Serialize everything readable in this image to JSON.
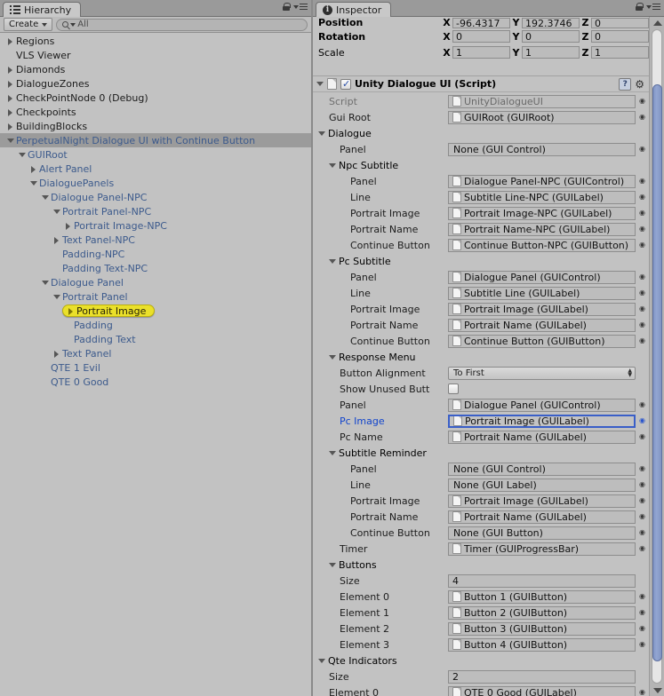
{
  "hierarchy": {
    "tab_label": "Hierarchy",
    "tab_icon": "list-icon",
    "create_label": "Create",
    "search_placeholder": "All",
    "search_value": "All",
    "lock_icon": "lock-icon",
    "menu_icon": "panel-menu-icon",
    "items": [
      {
        "label": "Regions",
        "indent": 0,
        "arrow": "right",
        "style": "normal"
      },
      {
        "label": "VLS Viewer",
        "indent": 0,
        "arrow": "none",
        "style": "normal"
      },
      {
        "label": "Diamonds",
        "indent": 0,
        "arrow": "right",
        "style": "normal"
      },
      {
        "label": "DialogueZones",
        "indent": 0,
        "arrow": "right",
        "style": "normal"
      },
      {
        "label": "CheckPointNode 0 (Debug)",
        "indent": 0,
        "arrow": "right",
        "style": "normal"
      },
      {
        "label": "Checkpoints",
        "indent": 0,
        "arrow": "right",
        "style": "normal"
      },
      {
        "label": "BuildingBlocks",
        "indent": 0,
        "arrow": "right",
        "style": "normal"
      },
      {
        "label": "PerpetualNight Dialogue UI with Continue Button",
        "indent": 0,
        "arrow": "down",
        "style": "prefab",
        "selected": true
      },
      {
        "label": "GUIRoot",
        "indent": 1,
        "arrow": "down",
        "style": "prefab"
      },
      {
        "label": "Alert Panel",
        "indent": 2,
        "arrow": "right",
        "style": "prefab"
      },
      {
        "label": "DialoguePanels",
        "indent": 2,
        "arrow": "down",
        "style": "prefab"
      },
      {
        "label": "Dialogue Panel-NPC",
        "indent": 3,
        "arrow": "down",
        "style": "prefab"
      },
      {
        "label": "Portrait Panel-NPC",
        "indent": 4,
        "arrow": "down",
        "style": "prefab"
      },
      {
        "label": "Portrait Image-NPC",
        "indent": 5,
        "arrow": "right",
        "style": "prefab"
      },
      {
        "label": "Text Panel-NPC",
        "indent": 4,
        "arrow": "right",
        "style": "prefab"
      },
      {
        "label": "Padding-NPC",
        "indent": 4,
        "arrow": "none",
        "style": "prefab"
      },
      {
        "label": "Padding Text-NPC",
        "indent": 4,
        "arrow": "none",
        "style": "prefab"
      },
      {
        "label": "Dialogue Panel",
        "indent": 3,
        "arrow": "down",
        "style": "prefab"
      },
      {
        "label": "Portrait Panel",
        "indent": 4,
        "arrow": "down",
        "style": "prefab"
      },
      {
        "label": "Portrait Image",
        "indent": 5,
        "arrow": "right",
        "style": "prefab",
        "highlight": true
      },
      {
        "label": "Padding",
        "indent": 5,
        "arrow": "none",
        "style": "prefab"
      },
      {
        "label": "Padding Text",
        "indent": 5,
        "arrow": "none",
        "style": "prefab"
      },
      {
        "label": "Text Panel",
        "indent": 4,
        "arrow": "right",
        "style": "prefab"
      },
      {
        "label": "QTE 1 Evil",
        "indent": 3,
        "arrow": "none",
        "style": "prefab"
      },
      {
        "label": "QTE 0 Good",
        "indent": 3,
        "arrow": "none",
        "style": "prefab"
      }
    ]
  },
  "inspector": {
    "tab_label": "Inspector",
    "tab_icon": "info-icon",
    "lock_icon": "lock-icon",
    "menu_icon": "panel-menu-icon",
    "transform": [
      {
        "label": "Position",
        "bold": true,
        "x": "-96.4317",
        "y": "192.3746",
        "z": "0",
        "clipped": true
      },
      {
        "label": "Rotation",
        "bold": true,
        "x": "0",
        "y": "0",
        "z": "0"
      },
      {
        "label": "Scale",
        "bold": false,
        "x": "1",
        "y": "1",
        "z": "1"
      }
    ],
    "axis_labels": [
      "X",
      "Y",
      "Z"
    ],
    "component": {
      "title": "Unity Dialogue UI (Script)",
      "enabled": true,
      "foldout": "down",
      "script_icon": "script-file-icon",
      "checkbox_icon": "enabled-checkbox",
      "help_icon": "help-icon",
      "help_label": "?",
      "gear_icon": "gear-icon"
    },
    "properties": [
      {
        "kind": "field",
        "label": "Script",
        "indent": 1,
        "value": "UnityDialogueUI",
        "obj": true,
        "dim": true,
        "picker": true
      },
      {
        "kind": "field",
        "label": "Gui Root",
        "indent": 1,
        "value": "GUIRoot (GUIRoot)",
        "obj": true,
        "picker": true
      },
      {
        "kind": "foldout",
        "label": "Dialogue",
        "indent": 0,
        "arrow": "down"
      },
      {
        "kind": "field",
        "label": "Panel",
        "indent": 2,
        "value": "None (GUI Control)",
        "obj": false,
        "picker": true
      },
      {
        "kind": "foldout",
        "label": "Npc Subtitle",
        "indent": 1,
        "arrow": "down"
      },
      {
        "kind": "field",
        "label": "Panel",
        "indent": 3,
        "value": "Dialogue Panel-NPC (GUIControl)",
        "obj": true,
        "picker": true
      },
      {
        "kind": "field",
        "label": "Line",
        "indent": 3,
        "value": "Subtitle Line-NPC (GUILabel)",
        "obj": true,
        "picker": true
      },
      {
        "kind": "field",
        "label": "Portrait Image",
        "indent": 3,
        "value": "Portrait Image-NPC (GUILabel)",
        "obj": true,
        "picker": true
      },
      {
        "kind": "field",
        "label": "Portrait Name",
        "indent": 3,
        "value": "Portrait Name-NPC (GUILabel)",
        "obj": true,
        "picker": true
      },
      {
        "kind": "field",
        "label": "Continue Button",
        "indent": 3,
        "value": "Continue Button-NPC (GUIButton)",
        "obj": true,
        "picker": true
      },
      {
        "kind": "foldout",
        "label": "Pc Subtitle",
        "indent": 1,
        "arrow": "down"
      },
      {
        "kind": "field",
        "label": "Panel",
        "indent": 3,
        "value": "Dialogue Panel (GUIControl)",
        "obj": true,
        "picker": true
      },
      {
        "kind": "field",
        "label": "Line",
        "indent": 3,
        "value": "Subtitle Line (GUILabel)",
        "obj": true,
        "picker": true
      },
      {
        "kind": "field",
        "label": "Portrait Image",
        "indent": 3,
        "value": "Portrait Image (GUILabel)",
        "obj": true,
        "picker": true
      },
      {
        "kind": "field",
        "label": "Portrait Name",
        "indent": 3,
        "value": "Portrait Name (GUILabel)",
        "obj": true,
        "picker": true
      },
      {
        "kind": "field",
        "label": "Continue Button",
        "indent": 3,
        "value": "Continue Button (GUIButton)",
        "obj": true,
        "picker": true
      },
      {
        "kind": "foldout",
        "label": "Response Menu",
        "indent": 1,
        "arrow": "down"
      },
      {
        "kind": "popup",
        "label": "Button Alignment",
        "indent": 2,
        "value": "To First"
      },
      {
        "kind": "check",
        "label": "Show Unused Butt",
        "indent": 2,
        "checked": false
      },
      {
        "kind": "field",
        "label": "Panel",
        "indent": 2,
        "value": "Dialogue Panel (GUIControl)",
        "obj": true,
        "picker": true
      },
      {
        "kind": "field",
        "label": "Pc Image",
        "indent": 2,
        "value": "Portrait Image (GUILabel)",
        "obj": true,
        "picker": true,
        "selected": true
      },
      {
        "kind": "field",
        "label": "Pc Name",
        "indent": 2,
        "value": "Portrait Name (GUILabel)",
        "obj": true,
        "picker": true
      },
      {
        "kind": "foldout",
        "label": "Subtitle Reminder",
        "indent": 1,
        "arrow": "down"
      },
      {
        "kind": "field",
        "label": "Panel",
        "indent": 3,
        "value": "None (GUI Control)",
        "obj": false,
        "picker": true
      },
      {
        "kind": "field",
        "label": "Line",
        "indent": 3,
        "value": "None (GUI Label)",
        "obj": false,
        "picker": true
      },
      {
        "kind": "field",
        "label": "Portrait Image",
        "indent": 3,
        "value": "Portrait Image (GUILabel)",
        "obj": true,
        "picker": true
      },
      {
        "kind": "field",
        "label": "Portrait Name",
        "indent": 3,
        "value": "Portrait Name (GUILabel)",
        "obj": true,
        "picker": true
      },
      {
        "kind": "field",
        "label": "Continue Button",
        "indent": 3,
        "value": "None (GUI Button)",
        "obj": false,
        "picker": true,
        "tight": true
      },
      {
        "kind": "field",
        "label": "Timer",
        "indent": 2,
        "value": "Timer (GUIProgressBar)",
        "obj": true,
        "picker": true
      },
      {
        "kind": "foldout",
        "label": "Buttons",
        "indent": 1,
        "arrow": "down"
      },
      {
        "kind": "text",
        "label": "Size",
        "indent": 2,
        "value": "4"
      },
      {
        "kind": "field",
        "label": "Element 0",
        "indent": 2,
        "value": "Button 1 (GUIButton)",
        "obj": true,
        "picker": true
      },
      {
        "kind": "field",
        "label": "Element 1",
        "indent": 2,
        "value": "Button 2 (GUIButton)",
        "obj": true,
        "picker": true
      },
      {
        "kind": "field",
        "label": "Element 2",
        "indent": 2,
        "value": "Button 3 (GUIButton)",
        "obj": true,
        "picker": true
      },
      {
        "kind": "field",
        "label": "Element 3",
        "indent": 2,
        "value": "Button 4 (GUIButton)",
        "obj": true,
        "picker": true
      },
      {
        "kind": "foldout",
        "label": "Qte Indicators",
        "indent": 0,
        "arrow": "down"
      },
      {
        "kind": "text",
        "label": "Size",
        "indent": 1,
        "value": "2"
      },
      {
        "kind": "field",
        "label": "Element 0",
        "indent": 1,
        "value": "QTE 0 Good (GUILabel)",
        "obj": true,
        "picker": true
      }
    ],
    "scrollbar": {
      "up_icon": "scroll-up-arrow",
      "down_icon": "scroll-down-arrow"
    }
  },
  "colors": {
    "panel_bg": "#c2c2c2",
    "selection": "#9b9b9b",
    "prefab_text": "#3c5a8c",
    "highlight_yellow": "#eae02a",
    "focus_blue": "#3a5fc8",
    "scroll_thumb": "#8194c2"
  }
}
